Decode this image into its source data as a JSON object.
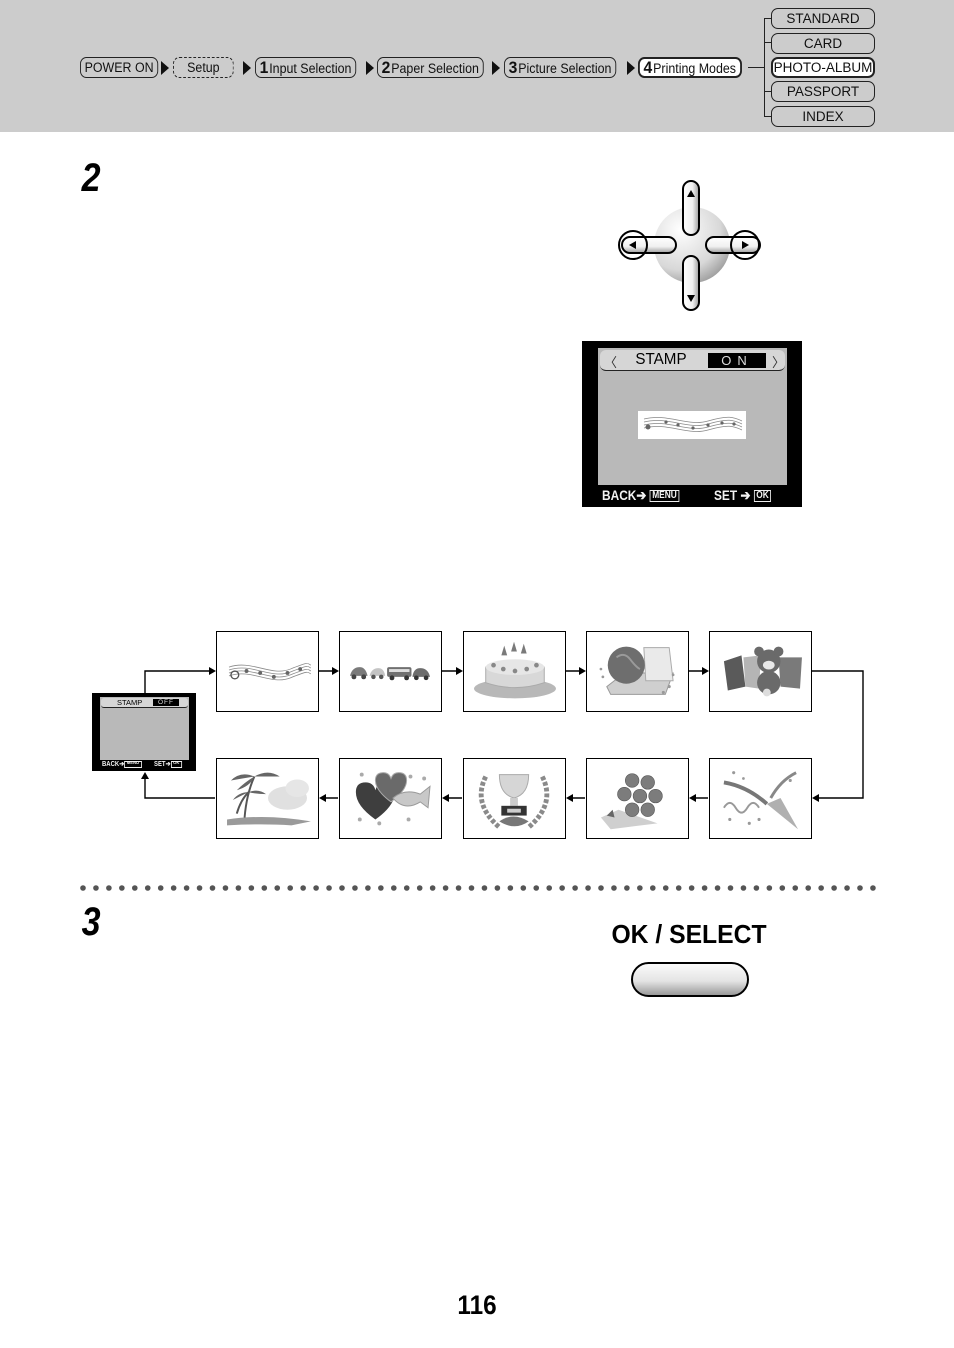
{
  "breadcrumb": {
    "items": [
      {
        "label": "POWER ON",
        "num": "",
        "style": "normal"
      },
      {
        "label": "Setup",
        "num": "",
        "style": "dashed"
      },
      {
        "label": "Input Selection",
        "num": "1",
        "style": "normal"
      },
      {
        "label": "Paper Selection",
        "num": "2",
        "style": "normal"
      },
      {
        "label": "Picture Selection",
        "num": "3",
        "style": "normal"
      },
      {
        "label": "Printing Modes",
        "num": "4",
        "style": "active"
      }
    ]
  },
  "printing_modes": {
    "items": [
      "STANDARD",
      "CARD",
      "PHOTO-ALBUM",
      "PASSPORT",
      "INDEX"
    ],
    "selected": "PHOTO-ALBUM"
  },
  "steps": {
    "step2": "2",
    "step3": "3"
  },
  "dpad": {
    "buttons": [
      "up",
      "down",
      "left",
      "right"
    ],
    "highlighted": [
      "left",
      "right"
    ]
  },
  "lcd_main": {
    "setting": "STAMP",
    "value": "ON",
    "stamp": "music-notes",
    "back_label": "BACK",
    "back_key": "MENU",
    "set_label": "SET",
    "set_key": "OK"
  },
  "lcd_off": {
    "setting": "STAMP",
    "value": "OFF",
    "back_label": "BACK",
    "back_key": "MENU",
    "set_label": "SET",
    "set_key": "OK"
  },
  "stamp_cycle": {
    "top_row": [
      "music-notes",
      "cars",
      "birthday-cake",
      "globe-suitcase",
      "teddy-bear"
    ],
    "bottom_row_right_to_left": [
      "party-popper",
      "roses-bouquet",
      "trophy-wreath",
      "hearts-candy",
      "palm-beach"
    ]
  },
  "ok_select": {
    "label": "OK / SELECT"
  },
  "page_number": "116"
}
